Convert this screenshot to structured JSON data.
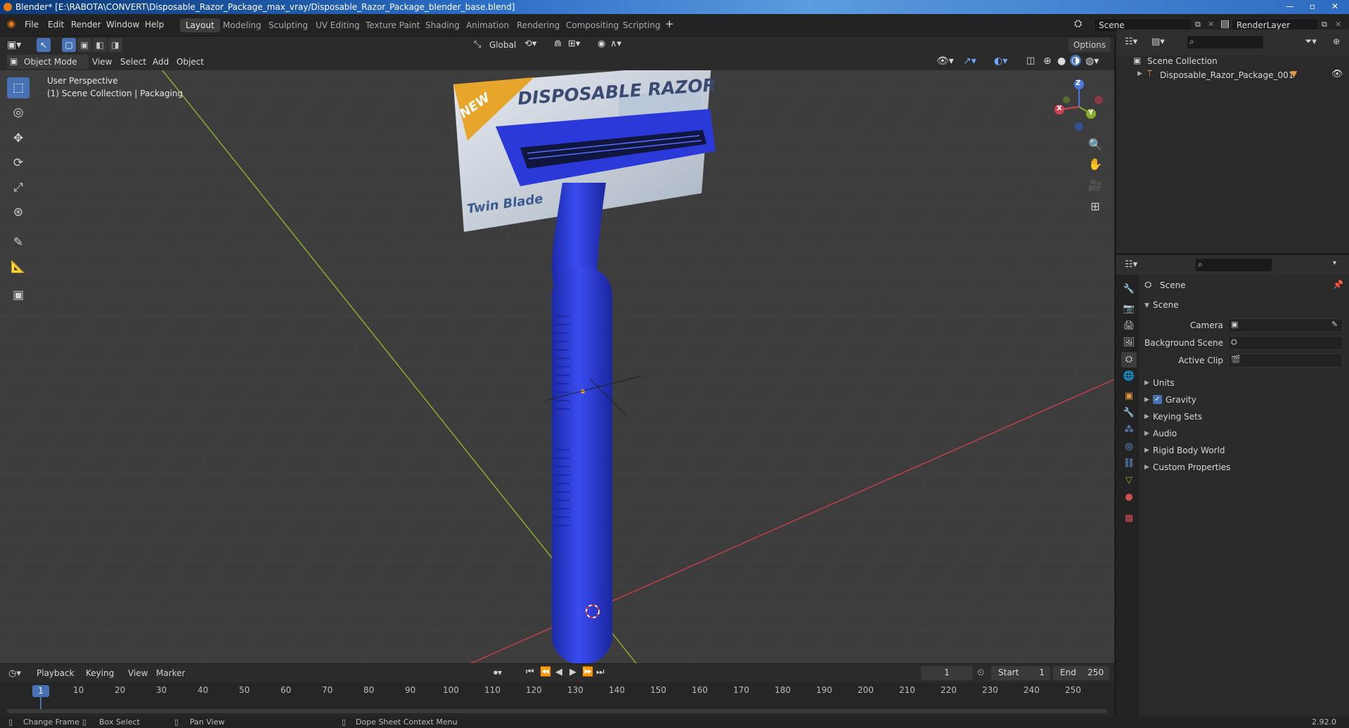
{
  "window": {
    "title": "Blender* [E:\\RABOTA\\CONVERT\\Disposable_Razor_Package_max_vray/Disposable_Razor_Package_blender_base.blend]"
  },
  "menu": [
    "File",
    "Edit",
    "Render",
    "Window",
    "Help"
  ],
  "workspaces": [
    "Layout",
    "Modeling",
    "Sculpting",
    "UV Editing",
    "Texture Paint",
    "Shading",
    "Animation",
    "Rendering",
    "Compositing",
    "Scripting"
  ],
  "active_workspace": "Layout",
  "scene_field": "Scene",
  "renderlayer_field": "RenderLayer",
  "viewport_header": {
    "mode": "Object Mode",
    "menus": [
      "View",
      "Select",
      "Add",
      "Object"
    ],
    "transform_orientation": "Global",
    "options_label": "Options"
  },
  "viewport": {
    "perspective": "User Perspective",
    "collection_info": "(1) Scene Collection | Packaging",
    "package_text_main": "DISPOSABLE RAZOR",
    "package_text_new": "NEW",
    "package_text_sub": "Twin Blade",
    "gizmo": {
      "z": "Z",
      "y": "Y",
      "x": "X"
    },
    "colors": {
      "background": "#3d3d3d",
      "razor_blue": "#2233c8",
      "x_axis": "#c0404a",
      "y_axis": "#8aad2b"
    }
  },
  "outliner": {
    "root": "Scene Collection",
    "items": [
      {
        "label": "Disposable_Razor_Package_001"
      }
    ]
  },
  "properties": {
    "context_label": "Scene",
    "panel_title": "Scene",
    "fields": [
      {
        "label": "Camera"
      },
      {
        "label": "Background Scene"
      },
      {
        "label": "Active Clip"
      }
    ],
    "sections": [
      {
        "label": "Units",
        "checkbox": false
      },
      {
        "label": "Gravity",
        "checkbox": true
      },
      {
        "label": "Keying Sets",
        "checkbox": false
      },
      {
        "label": "Audio",
        "checkbox": false
      },
      {
        "label": "Rigid Body World",
        "checkbox": false
      },
      {
        "label": "Custom Properties",
        "checkbox": false
      }
    ]
  },
  "timeline": {
    "menus": [
      "Playback",
      "Keying",
      "View",
      "Marker"
    ],
    "current_frame": "1",
    "start_label": "Start",
    "start_value": "1",
    "end_label": "End",
    "end_value": "250",
    "ticks": [
      "1",
      "10",
      "20",
      "30",
      "40",
      "50",
      "60",
      "70",
      "80",
      "90",
      "100",
      "110",
      "120",
      "130",
      "140",
      "150",
      "160",
      "170",
      "180",
      "190",
      "200",
      "210",
      "220",
      "230",
      "240",
      "250"
    ]
  },
  "statusbar": {
    "items": [
      "Change Frame",
      "Box Select",
      "Pan View",
      "Dope Sheet Context Menu"
    ],
    "version": "2.92.0"
  }
}
